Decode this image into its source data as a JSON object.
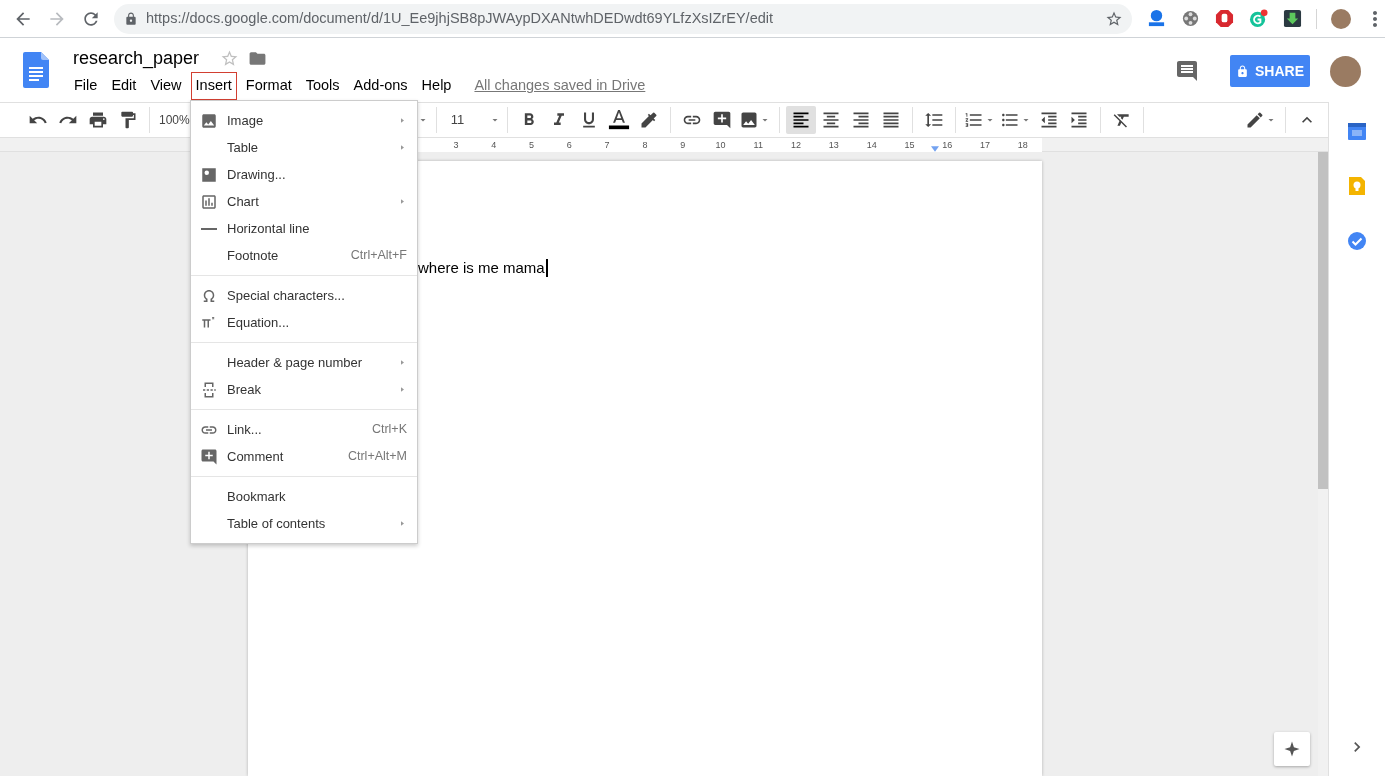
{
  "browser": {
    "url": "https://docs.google.com/document/d/1U_Ee9jhjSB8pJWAypDXANtwhDEDwdt69YLfzXsIZrEY/edit"
  },
  "document": {
    "title": "research_paper",
    "starred": false,
    "save_status": "All changes saved in Drive",
    "share_button": "SHARE",
    "menubar": [
      {
        "label": "File",
        "selected": false
      },
      {
        "label": "Edit",
        "selected": false
      },
      {
        "label": "View",
        "selected": false
      },
      {
        "label": "Insert",
        "selected": true
      },
      {
        "label": "Format",
        "selected": false
      },
      {
        "label": "Tools",
        "selected": false
      },
      {
        "label": "Add-ons",
        "selected": false
      },
      {
        "label": "Help",
        "selected": false
      }
    ]
  },
  "toolbar": {
    "zoom": "100%",
    "font_size": "11",
    "alignment": [
      {
        "selected": true
      },
      {
        "selected": false
      },
      {
        "selected": false
      },
      {
        "selected": false
      }
    ]
  },
  "ruler": {
    "labels": [
      "3",
      "4",
      "5",
      "6",
      "7",
      "8",
      "9",
      "10",
      "11",
      "12",
      "13",
      "14",
      "15",
      "16",
      "17",
      "18"
    ]
  },
  "page": {
    "text": "where is me mama"
  },
  "insert_menu": {
    "sections": [
      {
        "items": [
          {
            "label": "Image",
            "submenu": true
          },
          {
            "label": "Table",
            "submenu": true
          },
          {
            "label": "Drawing...",
            "submenu": false
          },
          {
            "label": "Chart",
            "submenu": true
          },
          {
            "label": "Horizontal line",
            "submenu": false
          },
          {
            "label": "Footnote",
            "shortcut": "Ctrl+Alt+F",
            "submenu": false
          }
        ]
      },
      {
        "items": [
          {
            "label": "Special characters...",
            "submenu": false
          },
          {
            "label": "Equation...",
            "submenu": false
          }
        ]
      },
      {
        "items": [
          {
            "label": "Header & page number",
            "submenu": true
          },
          {
            "label": "Break",
            "submenu": true
          }
        ]
      },
      {
        "items": [
          {
            "label": "Link...",
            "shortcut": "Ctrl+K",
            "submenu": false
          },
          {
            "label": "Comment",
            "shortcut": "Ctrl+Alt+M",
            "submenu": false
          }
        ]
      },
      {
        "items": [
          {
            "label": "Bookmark",
            "submenu": false
          },
          {
            "label": "Table of contents",
            "submenu": true
          }
        ]
      }
    ]
  }
}
